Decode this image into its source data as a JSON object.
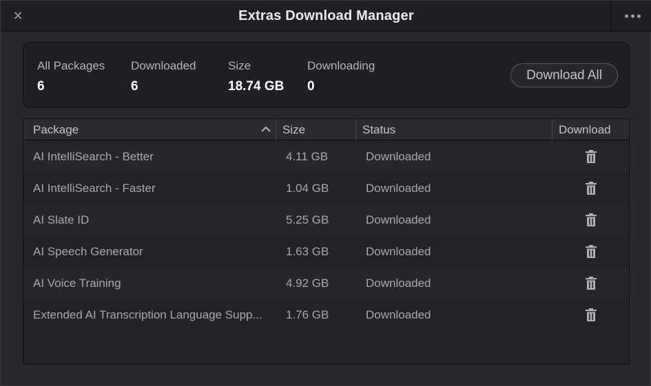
{
  "window": {
    "title": "Extras Download Manager",
    "close_icon": "close-icon",
    "more_icon": "more-horizontal-icon"
  },
  "summary": {
    "all_packages": {
      "label": "All Packages",
      "value": "6"
    },
    "downloaded": {
      "label": "Downloaded",
      "value": "6"
    },
    "size": {
      "label": "Size",
      "value": "18.74 GB"
    },
    "downloading": {
      "label": "Downloading",
      "value": "0"
    },
    "download_all_label": "Download All"
  },
  "table": {
    "headers": {
      "package": "Package",
      "size": "Size",
      "status": "Status",
      "download": "Download"
    },
    "sort": {
      "column": "package",
      "direction": "ascending"
    },
    "rows": [
      {
        "name": "AI IntelliSearch - Better",
        "size": "4.11 GB",
        "status": "Downloaded",
        "action_icon": "trash-icon"
      },
      {
        "name": "AI IntelliSearch - Faster",
        "size": "1.04 GB",
        "status": "Downloaded",
        "action_icon": "trash-icon"
      },
      {
        "name": "AI Slate ID",
        "size": "5.25 GB",
        "status": "Downloaded",
        "action_icon": "trash-icon"
      },
      {
        "name": "AI Speech Generator",
        "size": "1.63 GB",
        "status": "Downloaded",
        "action_icon": "trash-icon"
      },
      {
        "name": "AI Voice Training",
        "size": "4.92 GB",
        "status": "Downloaded",
        "action_icon": "trash-icon"
      },
      {
        "name": "Extended AI Transcription Language Supp...",
        "size": "1.76 GB",
        "status": "Downloaded",
        "action_icon": "trash-icon"
      }
    ]
  },
  "colors": {
    "background": "#28282e",
    "panel": "#1f1f24",
    "text_primary": "#ffffff",
    "text_secondary": "#a8a8ae"
  }
}
